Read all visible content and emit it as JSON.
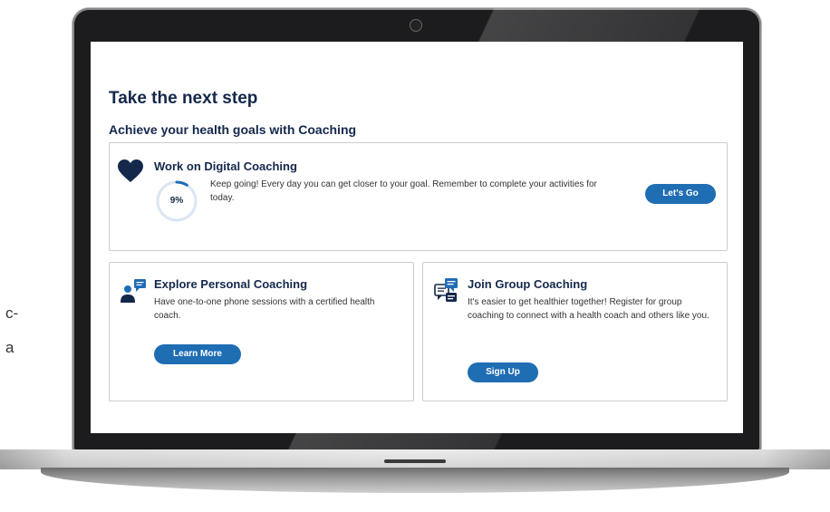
{
  "background_text": {
    "line1": "c-",
    "line2": "a"
  },
  "page": {
    "heading": "Take the next step",
    "subheading": "Achieve your health goals with Coaching"
  },
  "digital_coaching": {
    "title": "Work on Digital Coaching",
    "progress_label": "9%",
    "progress_value": 0.09,
    "description": "Keep going! Every day you can get closer to your goal. Remember to complete your activities for today.",
    "button_label": "Let's Go",
    "icon": "heart-icon"
  },
  "personal_coaching": {
    "title": "Explore Personal Coaching",
    "description": "Have one-to-one phone sessions with a certified health coach.",
    "button_label": "Learn More",
    "icon": "person-chat-icon"
  },
  "group_coaching": {
    "title": "Join Group Coaching",
    "description": "It's easier to get healthier together! Register for group coaching to connect with a health coach and others like you.",
    "button_label": "Sign Up",
    "icon": "group-chat-icon"
  },
  "colors": {
    "heading": "#14284b",
    "button": "#1f6db3",
    "progress_track": "#dbe6f3",
    "progress_fill": "#1f6db3",
    "card_border": "#c9ccd1"
  }
}
